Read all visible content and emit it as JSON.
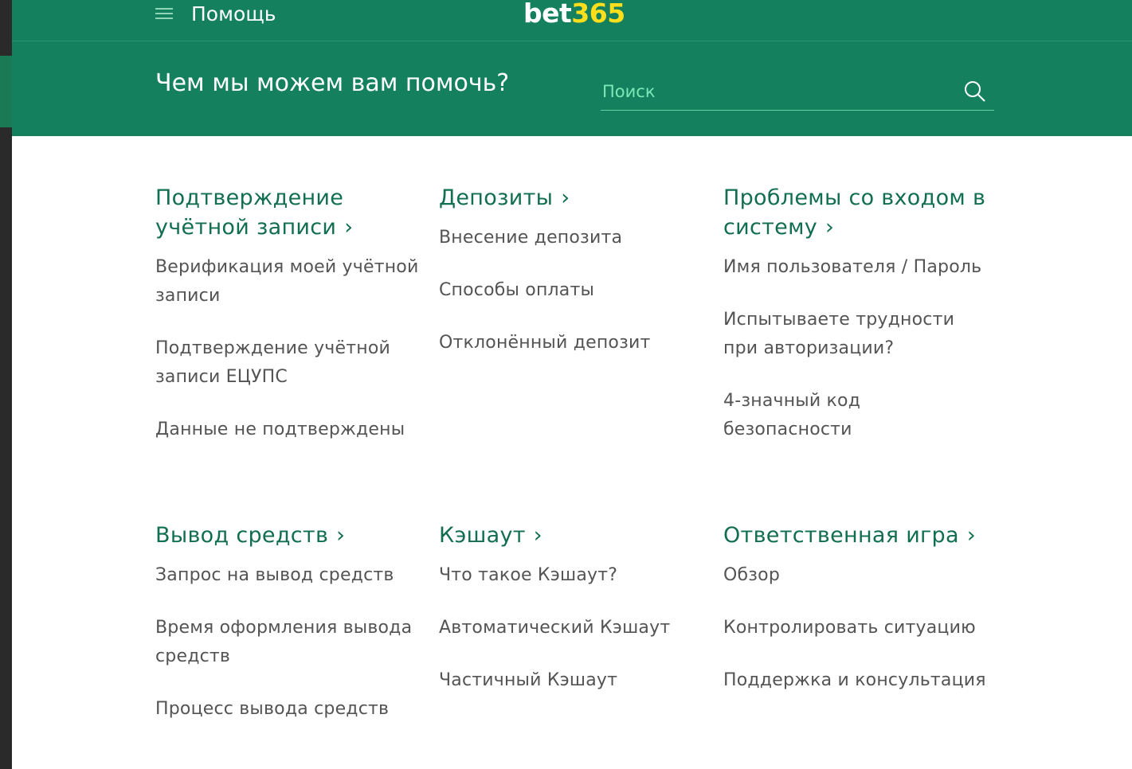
{
  "header": {
    "help_label": "Помощь",
    "logo_bet": "bet",
    "logo_num": "365"
  },
  "hero": {
    "title": "Чем мы можем вам помочь?",
    "search_placeholder": "Поиск"
  },
  "colors": {
    "brand_green": "#14805e",
    "logo_yellow": "#ffdf1b",
    "category_green": "#126e51",
    "link_gray": "#545454"
  },
  "categories": [
    {
      "title": "Подтверждение учётной записи",
      "links": [
        "Верификация моей учётной записи",
        "Подтверждение учётной записи ЕЦУПС",
        "Данные не подтверждены"
      ]
    },
    {
      "title": "Депозиты",
      "links": [
        "Внесение депозита",
        "Способы оплаты",
        "Отклонённый депозит"
      ]
    },
    {
      "title": "Проблемы со входом в систему",
      "links": [
        "Имя пользователя / Пароль",
        "Испытываете трудности при авторизации?",
        "4-значный код безопасности"
      ]
    },
    {
      "title": "Вывод средств",
      "links": [
        "Запрос на вывод средств",
        "Время оформления вывода средств",
        "Процесс вывода средств"
      ]
    },
    {
      "title": "Кэшаут",
      "links": [
        "Что такое Кэшаут?",
        "Автоматический Кэшаут",
        "Частичный Кэшаут"
      ]
    },
    {
      "title": "Ответственная игра",
      "links": [
        "Обзор",
        "Контролировать ситуацию",
        "Поддержка и консультация"
      ]
    }
  ]
}
